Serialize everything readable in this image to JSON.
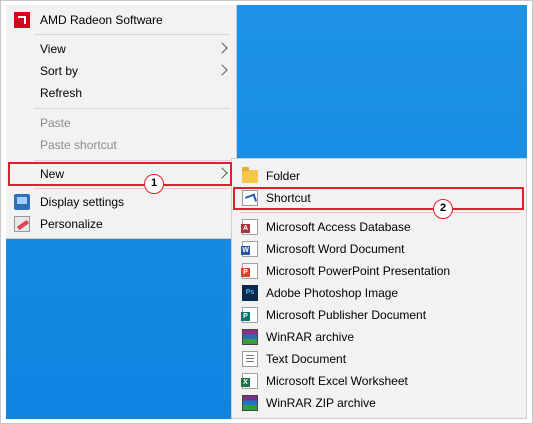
{
  "context_menu": {
    "items": [
      {
        "label": "AMD Radeon Software",
        "icon": "amd-icon"
      },
      {
        "label": "View",
        "has_submenu": true
      },
      {
        "label": "Sort by",
        "has_submenu": true
      },
      {
        "label": "Refresh"
      },
      {
        "label": "Paste",
        "disabled": true
      },
      {
        "label": "Paste shortcut",
        "disabled": true
      },
      {
        "label": "New",
        "has_submenu": true,
        "highlighted": true
      },
      {
        "label": "Display settings",
        "icon": "display-icon"
      },
      {
        "label": "Personalize",
        "icon": "personalize-icon"
      }
    ]
  },
  "new_submenu": {
    "items": [
      {
        "label": "Folder",
        "icon": "folder-icon"
      },
      {
        "label": "Shortcut",
        "icon": "shortcut-icon",
        "highlighted": true
      },
      {
        "label": "Microsoft Access Database",
        "icon": "access-icon"
      },
      {
        "label": "Microsoft Word Document",
        "icon": "word-icon"
      },
      {
        "label": "Microsoft PowerPoint Presentation",
        "icon": "powerpoint-icon"
      },
      {
        "label": "Adobe Photoshop Image",
        "icon": "photoshop-icon"
      },
      {
        "label": "Microsoft Publisher Document",
        "icon": "publisher-icon"
      },
      {
        "label": "WinRAR archive",
        "icon": "winrar-icon"
      },
      {
        "label": "Text Document",
        "icon": "text-document-icon"
      },
      {
        "label": "Microsoft Excel Worksheet",
        "icon": "excel-icon"
      },
      {
        "label": "WinRAR ZIP archive",
        "icon": "winrar-zip-icon"
      }
    ]
  },
  "annotations": {
    "step1": "1",
    "step2": "2"
  },
  "colors": {
    "desktop": "#0d84e0",
    "menu_bg": "#f2f2f2",
    "annotation": "#e01f2b"
  }
}
